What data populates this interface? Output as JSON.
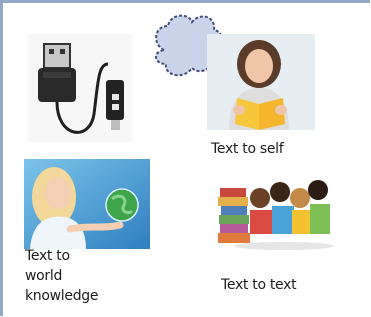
{
  "captions": {
    "text_to_self": "Text to self",
    "text_to_world_line1": "Text to",
    "text_to_world_line2": "world",
    "text_to_world_line3": "knowledge",
    "text_to_text": "Text to text"
  },
  "icons": {
    "cable": "usb-cable-icon",
    "thought": "thought-bubble-icon",
    "self": "woman-reading-image",
    "world": "woman-holding-globe-image",
    "text": "children-with-books-image"
  },
  "colors": {
    "frame": "#8fa9c7",
    "bubble_fill": "#c9d4ea",
    "bubble_stroke": "#3f4c7a",
    "book_yellow": "#f6c73a",
    "world_blue": "#4aa3d8",
    "globe_green": "#3fa54a"
  }
}
